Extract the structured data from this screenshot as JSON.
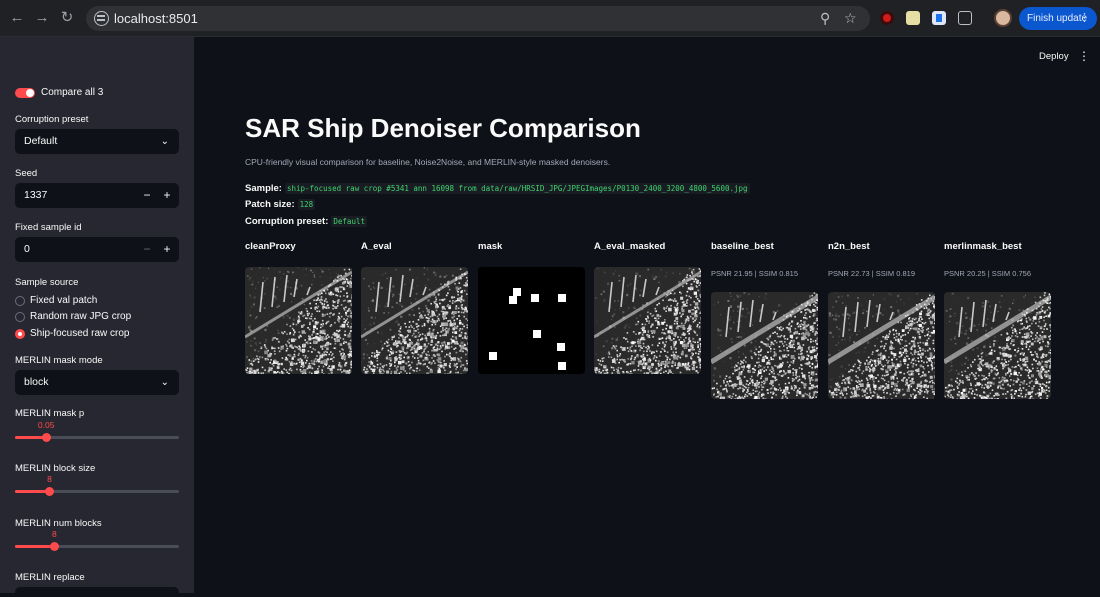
{
  "browser": {
    "url": "localhost:8501",
    "finish_update_label": "Finish update"
  },
  "sidebar": {
    "compare_all": "Compare all 3",
    "corruption_preset_label": "Corruption preset",
    "corruption_preset_value": "Default",
    "seed_label": "Seed",
    "seed_value": "1337",
    "fixed_sample_label": "Fixed sample id",
    "fixed_sample_value": "0",
    "sample_source_label": "Sample source",
    "sample_source_options": [
      "Fixed val patch",
      "Random raw JPG crop",
      "Ship-focused raw crop"
    ],
    "sample_source_selected": 2,
    "merlin_mode_label": "MERLIN mask mode",
    "merlin_mode_value": "block",
    "mask_p_label": "MERLIN mask p",
    "mask_p_value": "0.05",
    "mask_p_fraction": 0.19,
    "block_size_label": "MERLIN block size",
    "block_size_value": "8",
    "block_size_fraction": 0.21,
    "num_blocks_label": "MERLIN num blocks",
    "num_blocks_value": "8",
    "num_blocks_fraction": 0.24,
    "replace_label": "MERLIN replace"
  },
  "main": {
    "deploy_label": "Deploy",
    "title": "SAR Ship Denoiser Comparison",
    "subtitle": "CPU-friendly visual comparison for baseline, Noise2Noise, and MERLIN-style masked denoisers.",
    "sample_label": "Sample:",
    "sample_value": "ship-focused raw crop #5341 ann 16098 from data/raw/HRSID_JPG/JPEGImages/P0130_2400_3200_4800_5600.jpg",
    "patch_label": "Patch size:",
    "patch_value": "128",
    "preset_label": "Corruption preset:",
    "preset_value": "Default",
    "images": [
      {
        "caption": "cleanProxy",
        "metric": ""
      },
      {
        "caption": "A_eval",
        "metric": ""
      },
      {
        "caption": "mask",
        "metric": ""
      },
      {
        "caption": "A_eval_masked",
        "metric": ""
      },
      {
        "caption": "baseline_best",
        "metric": "PSNR 21.95 | SSIM 0.815"
      },
      {
        "caption": "n2n_best",
        "metric": "PSNR 22.73 | SSIM 0.819"
      },
      {
        "caption": "merlinmask_best",
        "metric": "PSNR 20.25 | SSIM 0.756"
      }
    ]
  },
  "colors": {
    "accent": "#ff4b4b",
    "code_green": "#3dd56d",
    "bg_main": "#0e1117",
    "bg_sidebar": "#262730"
  }
}
